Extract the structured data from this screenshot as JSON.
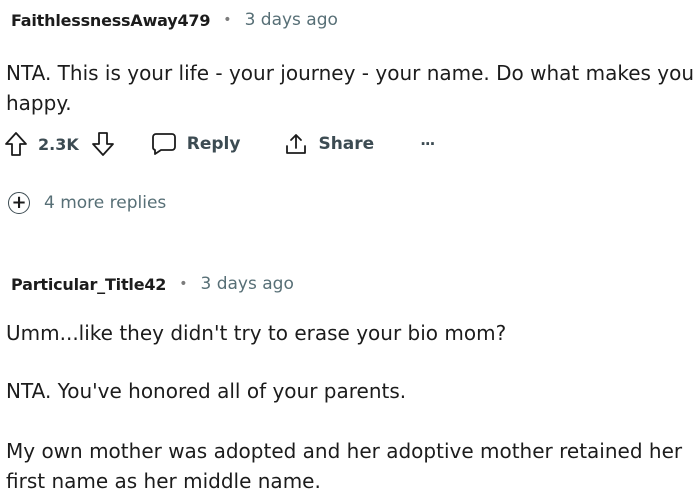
{
  "comments": [
    {
      "author": "FaithlessnessAway479",
      "separator": "•",
      "time": "3 days ago",
      "paragraphs": [
        "NTA. This is your life - your journey - your name. Do what makes you happy."
      ],
      "votes": "2.3K",
      "reply_label": "Reply",
      "share_label": "Share",
      "overflow_label": "···",
      "more_replies": "4 more replies"
    },
    {
      "author": "Particular_Title42",
      "separator": "•",
      "time": "3 days ago",
      "paragraphs": [
        "Umm...like they didn't try to erase your bio mom?",
        "NTA. You've honored all of your parents.",
        "My own mother was adopted and her adoptive mother retained her first name as her middle name."
      ]
    }
  ],
  "icons": {
    "upvote": "upvote-arrow-icon",
    "downvote": "downvote-arrow-icon",
    "reply": "speech-bubble-icon",
    "share": "share-arrow-icon",
    "overflow": "ellipsis-icon",
    "expand": "plus-circle-icon"
  }
}
